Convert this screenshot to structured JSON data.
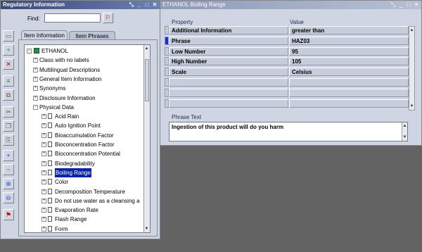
{
  "left_window": {
    "title": "Regulatory Information",
    "find_label": "Find:",
    "find_value": "",
    "tabs": [
      "Item Information",
      "Item Phrases"
    ],
    "tree": [
      {
        "label": "ETHANOL",
        "level": 0,
        "type": "root"
      },
      {
        "label": "Class with no labels",
        "level": 1,
        "type": "branch"
      },
      {
        "label": "Multilingual Descriptions",
        "level": 1,
        "type": "branch"
      },
      {
        "label": "General Item Information",
        "level": 1,
        "type": "branch"
      },
      {
        "label": "Synonyms",
        "level": 1,
        "type": "branch"
      },
      {
        "label": "Disclosure Information",
        "level": 1,
        "type": "branch"
      },
      {
        "label": "Physical Data",
        "level": 1,
        "type": "branch-open"
      },
      {
        "label": "Acid Rain",
        "level": 2,
        "type": "doc"
      },
      {
        "label": "Auto Ignition Point",
        "level": 2,
        "type": "doc"
      },
      {
        "label": "Bioaccumulation Factor",
        "level": 2,
        "type": "doc"
      },
      {
        "label": "Bioconcentration Factor",
        "level": 2,
        "type": "doc"
      },
      {
        "label": "Bioconcentration Potential",
        "level": 2,
        "type": "doc"
      },
      {
        "label": "Biodegradability",
        "level": 2,
        "type": "doc"
      },
      {
        "label": "Boiling Range",
        "level": 2,
        "type": "doc",
        "selected": true
      },
      {
        "label": "Color",
        "level": 2,
        "type": "doc"
      },
      {
        "label": "Decomposition Temperature",
        "level": 2,
        "type": "doc"
      },
      {
        "label": "Do not use water as a cleansing a",
        "level": 2,
        "type": "doc"
      },
      {
        "label": "Evaporation Rate",
        "level": 2,
        "type": "doc"
      },
      {
        "label": "Flash Range",
        "level": 2,
        "type": "doc"
      },
      {
        "label": "Form",
        "level": 2,
        "type": "doc"
      }
    ],
    "toolbar_icons": [
      "open-folder-icon",
      "new-item-icon",
      "delete-icon",
      "add-row-icon",
      "copy-icon",
      "cut-icon",
      "copy-doc-icon",
      "paste-icon",
      "expand-icon",
      "collapse-icon",
      "expand-all-icon",
      "collapse-all-icon",
      "flag-icon"
    ]
  },
  "right_window": {
    "title": "ETHANOL Boiling Range",
    "col_property": "Property",
    "col_value": "Value",
    "rows": [
      {
        "property": "Additional Information",
        "value": "greater than"
      },
      {
        "property": "Phrase",
        "value": "HAZ03",
        "current": true
      },
      {
        "property": "Low Number",
        "value": "95"
      },
      {
        "property": "High Number",
        "value": "105"
      },
      {
        "property": "Scale",
        "value": "Celsius"
      },
      {
        "property": "",
        "value": ""
      },
      {
        "property": "",
        "value": ""
      },
      {
        "property": "",
        "value": ""
      }
    ],
    "phrase_text_label": "Phrase Text",
    "phrase_text": "Ingestion of this product will do you harm"
  }
}
